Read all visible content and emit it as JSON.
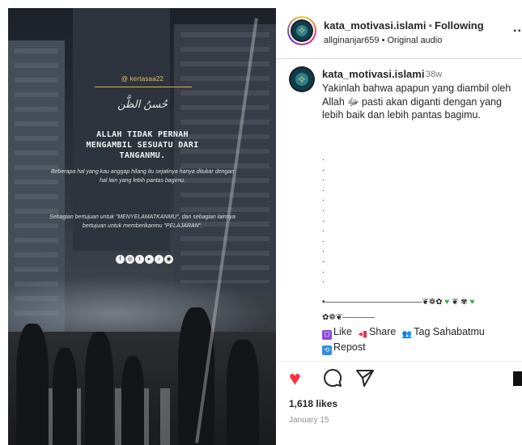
{
  "media": {
    "handle": "@ kertasaa22",
    "signature": "حُسنُ الظَّن",
    "headline": "ALLAH TIDAK PERNAH MENGAMBIL SESUATU DARI TANGANMU.",
    "paragraph1": "Beberapa hal yang kau anggap hilang itu sejatinya hanya ditukar dengan hal lain yang lebih pantas bagimu.",
    "paragraph2": "Sebagian bertujuan untuk \"MENYELAMATKANMU\", dan sebagian lainnya bertujuan untuk memberikanmu \"PELAJARAN\"."
  },
  "header": {
    "username": "kata_motivasi.islami",
    "separator": "•",
    "follow_status": "Following",
    "audio_user": "allginanjar659",
    "audio_label": "Original audio",
    "more": "..."
  },
  "caption": {
    "username": "kata_motivasi.islami",
    "time": "38w",
    "text": "Yakinlah bahwa apapun yang diambil oleh Allah ﷻ pasti akan diganti dengan yang lebih baik dan lebih pantas bagimu.",
    "deco_line1_a": "•————————————❦❁✿",
    "deco_line1_b": "❦ ✾",
    "deco_line2": "✿❁❦————",
    "like_label": "Like",
    "share_label": "Share",
    "tag_label": "Tag Sahabatmu",
    "repost_label": "Repost"
  },
  "stats": {
    "likes": "1,618 likes",
    "date": "January 15"
  },
  "colors": {
    "heart": "#ff3040",
    "accent_gold": "#e8c35a",
    "green_heart": "#2fb345"
  }
}
